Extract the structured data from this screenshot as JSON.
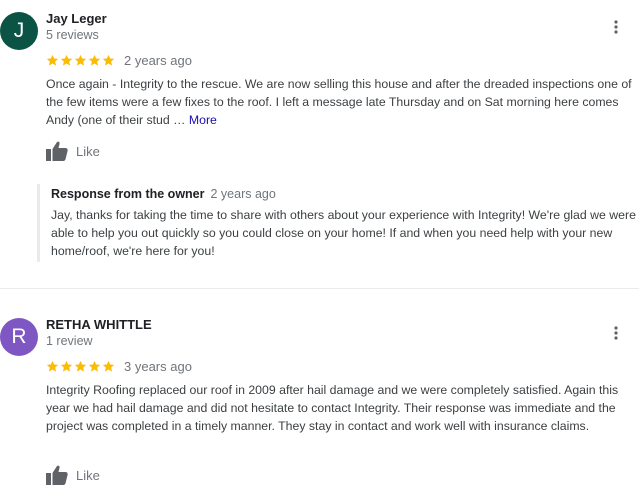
{
  "reviews": [
    {
      "avatar_letter": "J",
      "avatar_color": "#0b5345",
      "name": "Jay Leger",
      "review_count": "5 reviews",
      "rating": 5,
      "date": "2 years ago",
      "text": "Once again - Integrity to the rescue.  We are now selling this house and after the dreaded inspections one of the few items were a few fixes to the roof.  I left a message late Thursday and on Sat morning here comes Andy (one of their stud … ",
      "more_label": "More",
      "like_label": "Like",
      "owner_response": {
        "title": "Response from the owner",
        "date": "2 years ago",
        "text": "Jay, thanks for taking the time to share with others about your experience with Integrity! We're glad we were able to help you out quickly so you could close on your home! If and when you need help with your new home/roof, we're here for you!"
      }
    },
    {
      "avatar_letter": "R",
      "avatar_color": "#7e57c2",
      "name": "RETHA WHITTLE",
      "review_count": "1 review",
      "rating": 5,
      "date": "3 years ago",
      "text": "Integrity Roofing replaced our roof in 2009 after hail damage and we were completely satisfied. Again this year we had hail damage and did not hesitate to contact Integrity. Their response was immediate and the project was completed in a timely manner. They stay in contact and work well with insurance claims.",
      "like_label": "Like"
    }
  ],
  "colors": {
    "star": "#fbbc04",
    "link": "#1a0dab",
    "secondary_text": "#70757a",
    "icon": "#5f6368"
  },
  "icons": {
    "menu": "more-vert-icon",
    "like": "thumb-up-icon",
    "star": "star-icon"
  }
}
